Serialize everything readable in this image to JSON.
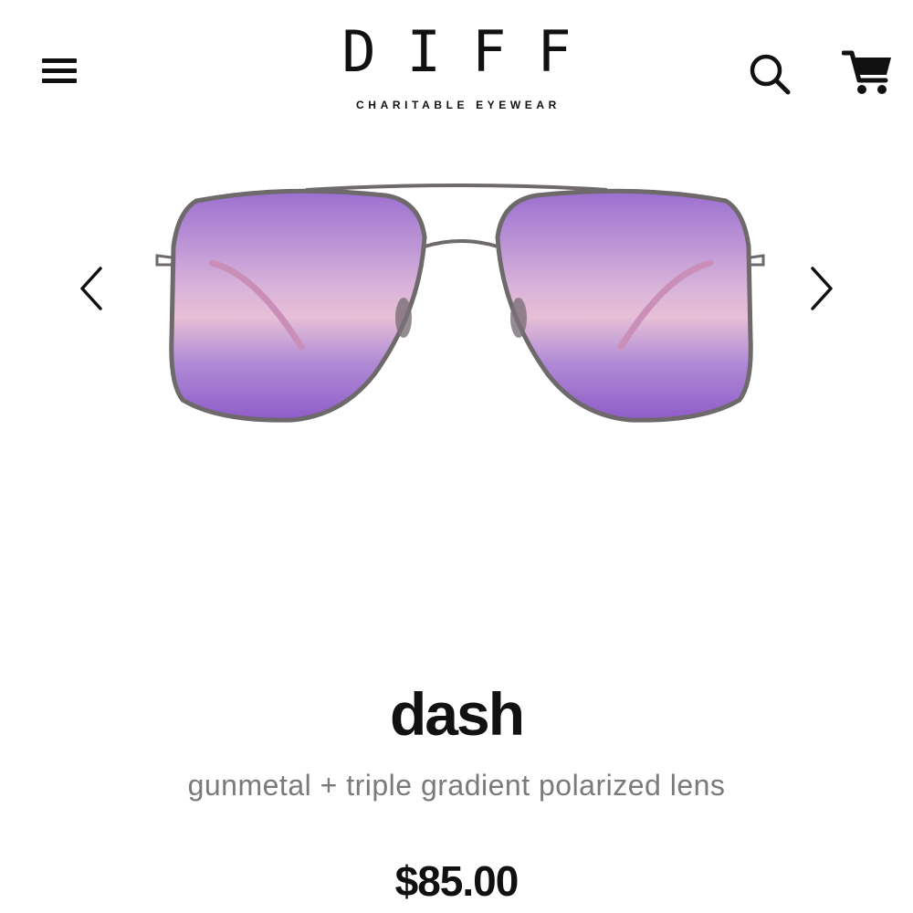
{
  "header": {
    "brand": "DIFF",
    "tagline": "CHARITABLE EYEWEAR",
    "menu_icon": "hamburger-menu-icon",
    "search_icon": "search-icon",
    "cart_icon": "shopping-cart-icon"
  },
  "carousel": {
    "prev_icon": "chevron-left-icon",
    "next_icon": "chevron-right-icon",
    "lens_colors": [
      "#9a6fd0",
      "#e7bfd6",
      "#8e5cc8"
    ],
    "frame_color": "#6e6a6c"
  },
  "product": {
    "name": "dash",
    "variant": "gunmetal + triple gradient polarized lens",
    "price": "$85.00"
  }
}
